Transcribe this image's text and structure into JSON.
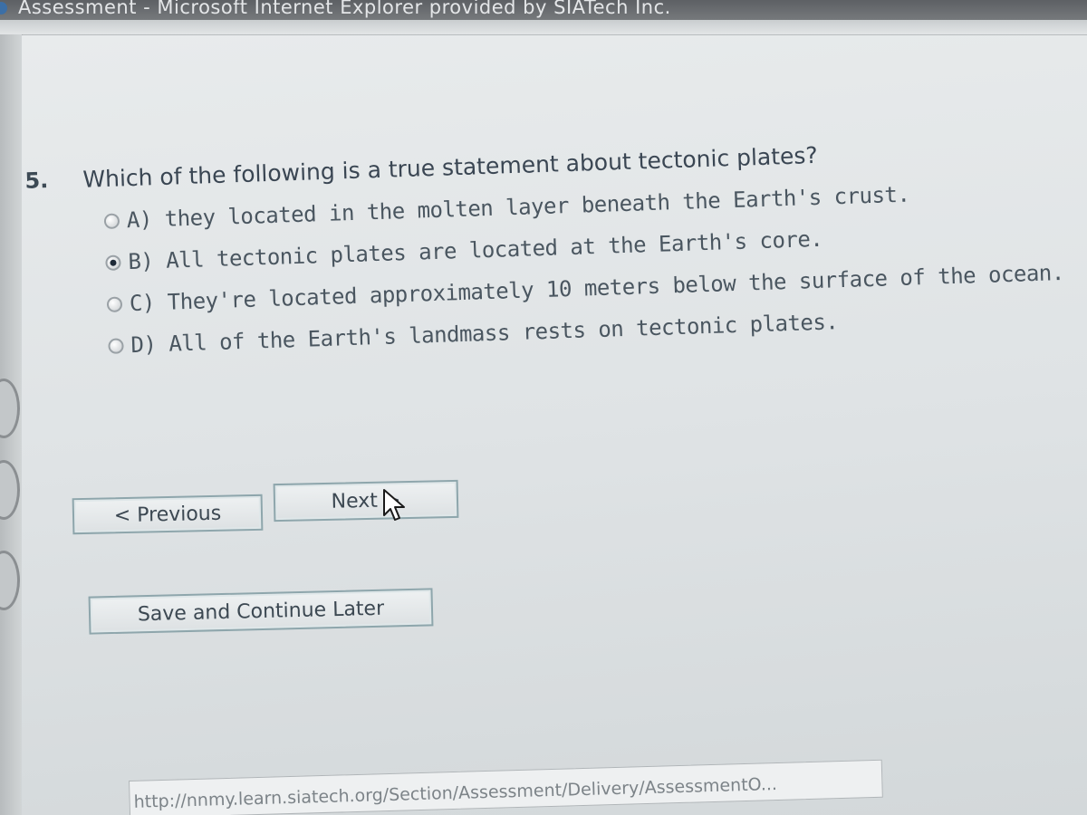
{
  "window": {
    "title": "Assessment - Microsoft Internet Explorer provided by SIATech Inc."
  },
  "question": {
    "number": "5.",
    "text": "Which of the following is a true statement about tectonic plates?",
    "options": [
      {
        "label": "A) they located in the molten layer beneath the Earth's crust.",
        "selected": false
      },
      {
        "label": "B) All tectonic plates are located at the Earth's core.",
        "selected": true
      },
      {
        "label": "C) They're located approximately 10 meters below the surface of the ocean.",
        "selected": false
      },
      {
        "label": "D) All of the Earth's landmass rests on tectonic plates.",
        "selected": false
      }
    ]
  },
  "navigation": {
    "previous_label": "< Previous",
    "next_label": "Next >",
    "save_label": "Save and Continue Later"
  },
  "status": {
    "url": "http://nnmy.learn.siatech.org/Section/Assessment/Delivery/AssessmentO..."
  },
  "colors": {
    "accent_border": "#8ea6ac",
    "text": "#3a4653"
  }
}
